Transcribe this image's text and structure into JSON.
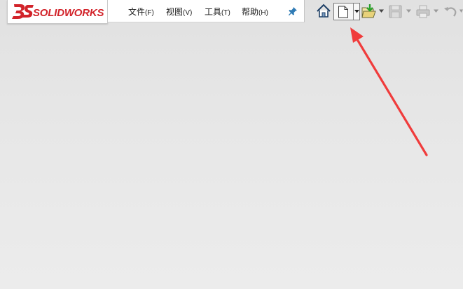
{
  "app": {
    "logo_text": "SOLIDWORKS",
    "brand_color": "#d2232a"
  },
  "menu": {
    "items": [
      {
        "label": "文件",
        "accel": "(F)"
      },
      {
        "label": "视图",
        "accel": "(V)"
      },
      {
        "label": "工具",
        "accel": "(T)"
      },
      {
        "label": "帮助",
        "accel": "(H)"
      }
    ]
  },
  "toolbar": {
    "icons": [
      "home-icon",
      "new-document-icon",
      "open-folder-icon",
      "save-icon",
      "print-icon",
      "undo-icon"
    ]
  },
  "annotation": {
    "arrow_color": "#f03c3c"
  }
}
